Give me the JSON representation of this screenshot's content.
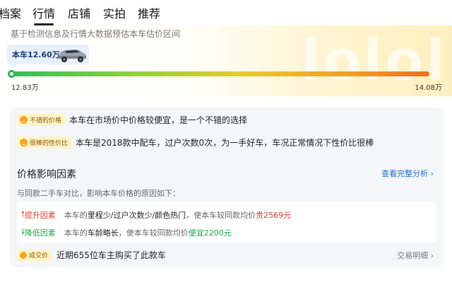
{
  "tabs": [
    "档案",
    "行情",
    "店铺",
    "实拍",
    "推荐"
  ],
  "active_tab": "行情",
  "hero": {
    "subtitle": "基于检测信息及行情大数据预估本车估价区间",
    "watermark": "lolol",
    "car_price_label": "本车12.60万",
    "car_icon": "suv-car-image",
    "range_min": "12.83万",
    "range_max": "14.08万"
  },
  "highlights": [
    {
      "badge": "不错的价格",
      "icon": "smile-face-icon",
      "text": "本车在市场价中价格较便宜，是一个不错的选择"
    },
    {
      "badge": "很棒的性价比",
      "icon": "smile-face-icon",
      "text": "本车是2018款中配车，过户次数0次，为一手好车，车况正常情况下性价比很棒"
    }
  ],
  "factors_section": {
    "title": "价格影响因素",
    "view_all": "查看完整分析",
    "description": "与同款二手车对比，影响本车价格的原因如下：",
    "up": {
      "label": "提升因素",
      "prefix": "本车的",
      "highlight": "里程少/过户次数少/颜色热门",
      "suffix": "，使本车较同款均价",
      "change": "贵2569元"
    },
    "down": {
      "label": "降低因素",
      "prefix": "本车的",
      "highlight": "车龄略长",
      "suffix": "，使本车较同款均价",
      "change": "便宜2200元"
    }
  },
  "deals": {
    "badge": "成交价",
    "text": "近期655位车主购买了此款车",
    "link": "交易明细"
  },
  "colors": {
    "accent_blue": "#1e6ed8",
    "up_red": "#e23a2f",
    "down_green": "#1ea94f",
    "badge_bg": "#fff3c8"
  }
}
